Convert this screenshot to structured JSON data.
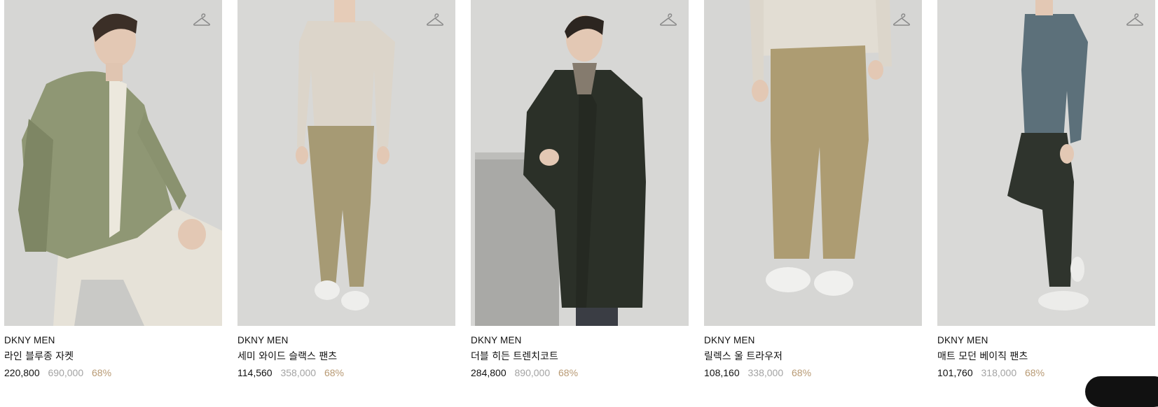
{
  "products": [
    {
      "brand": "DKNY MEN",
      "name": "라인 블루종 자켓",
      "sale_price": "220,800",
      "original_price": "690,000",
      "discount": "68%",
      "image_desc": "model in olive blouson jacket, seated"
    },
    {
      "brand": "DKNY MEN",
      "name": "세미 와이드 슬랙스 팬츠",
      "sale_price": "114,560",
      "original_price": "358,000",
      "discount": "68%",
      "image_desc": "model in beige knit and khaki slacks"
    },
    {
      "brand": "DKNY MEN",
      "name": "더블 히든 트렌치코트",
      "sale_price": "284,800",
      "original_price": "890,000",
      "discount": "68%",
      "image_desc": "model in dark green belted trench coat"
    },
    {
      "brand": "DKNY MEN",
      "name": "릴렉스 울 트라우저",
      "sale_price": "108,160",
      "original_price": "338,000",
      "discount": "68%",
      "image_desc": "khaki wool trousers with white sneakers"
    },
    {
      "brand": "DKNY MEN",
      "name": "매트 모던 베이직 팬츠",
      "sale_price": "101,760",
      "original_price": "318,000",
      "discount": "68%",
      "image_desc": "model in slate knit and dark pants"
    }
  ],
  "icons": {
    "wishlist": "hanger-icon"
  },
  "colors": {
    "discount": "#b89a74",
    "original_price": "#a3a3a3",
    "text": "#111111"
  }
}
